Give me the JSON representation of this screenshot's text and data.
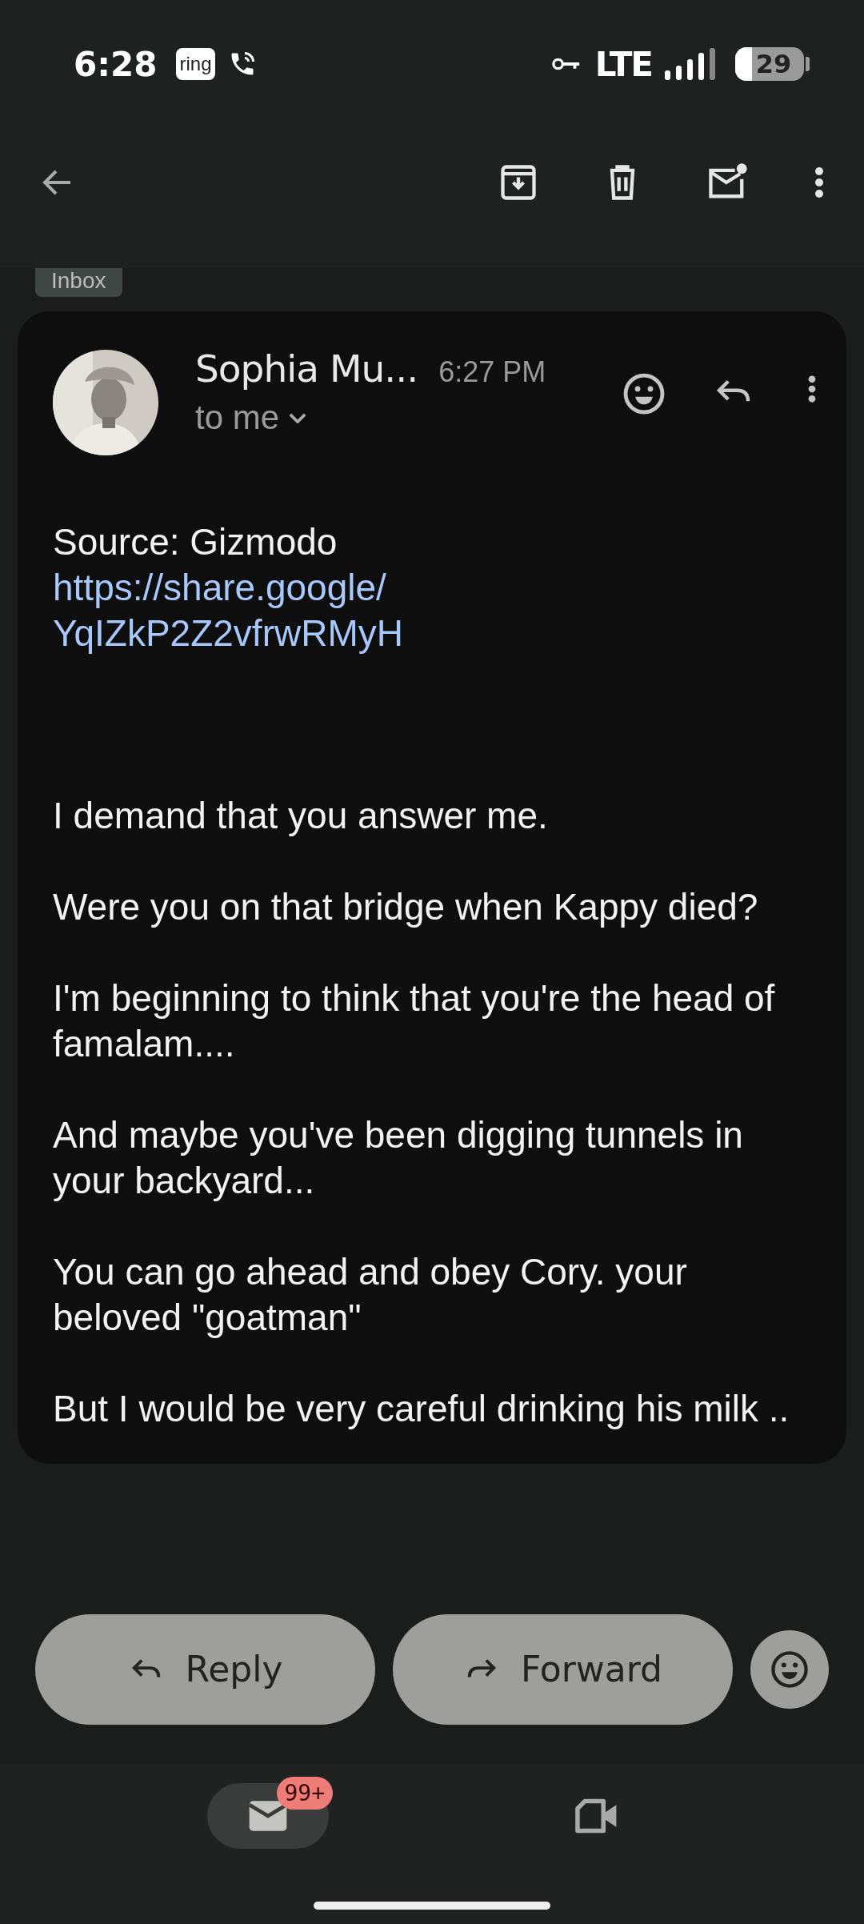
{
  "status_bar": {
    "time": "6:28",
    "ring_logo": "ring",
    "network": "LTE",
    "battery": "29"
  },
  "label_chip": "Inbox",
  "message": {
    "sender": "Sophia Mu...",
    "time": "6:27 PM",
    "recipient": "to me",
    "source": "Source: Gizmodo",
    "link": "https://share.google/YqIZkP2Z2vfrwRMyH",
    "paragraphs": [
      "I demand that you answer me.",
      "Were you on that bridge when Kappy died?",
      "I'm beginning to think that you're the head of famalam....",
      "And maybe you've been digging tunnels in your backyard...",
      "You can go ahead and obey Cory. your beloved \"goatman\"",
      "But I would be very careful drinking his milk .."
    ]
  },
  "actions": [
    {
      "kind": "reply",
      "label": "Reply"
    },
    {
      "kind": "forward",
      "label": "Forward"
    }
  ],
  "bottom_nav": [
    {
      "kind": "mail",
      "selected": true,
      "badge": "99+"
    },
    {
      "kind": "video",
      "selected": false
    }
  ]
}
